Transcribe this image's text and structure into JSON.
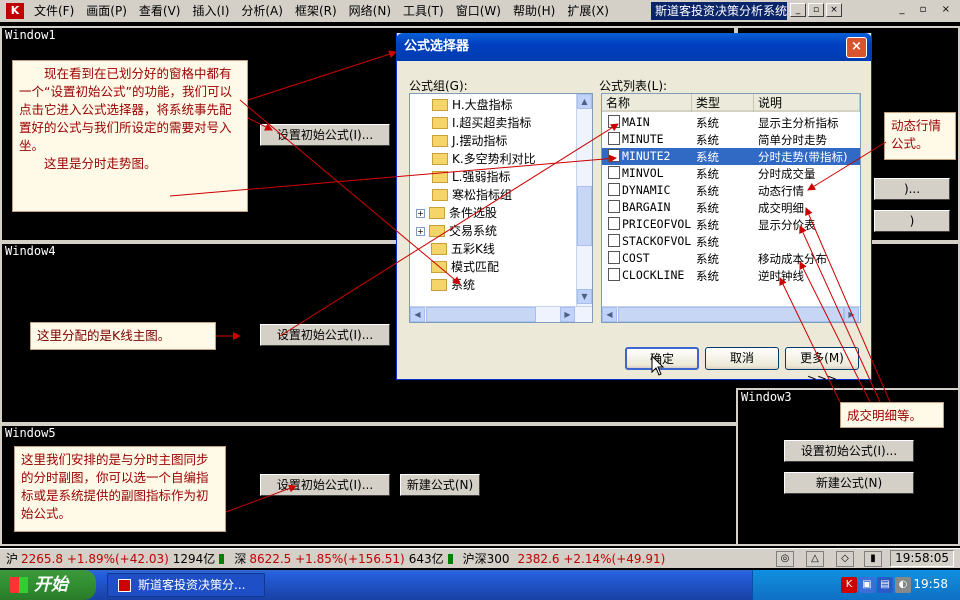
{
  "menubar": {
    "items": [
      "文件(F)",
      "画面(P)",
      "查看(V)",
      "插入(I)",
      "分析(A)",
      "框架(R)",
      "网络(N)",
      "工具(T)",
      "窗口(W)",
      "帮助(H)",
      "扩展(X)"
    ],
    "app_title": "斯道客投资决策分析系统"
  },
  "windows": {
    "w1": {
      "title": "Window1",
      "button": "设置初始公式(I)..."
    },
    "w4": {
      "title": "Window4",
      "button": "设置初始公式(I)..."
    },
    "w5": {
      "title": "Window5",
      "button": "设置初始公式(I)...",
      "button2": "新建公式(N)"
    },
    "w3": {
      "title": "Window3",
      "button": "设置初始公式(I)...",
      "button2": "新建公式(N)"
    }
  },
  "notes": {
    "n1": "　　现在看到在已划分好的窗格中都有一个“设置初始公式”的功能，我们可以点击它进入公式选择器，将系统事先配置好的公式与我们所设定的需要对号入坐。",
    "n1b": "　　这里是分时走势图。",
    "n2": "这里分配的是K线主图。",
    "n3": "这里我们安排的是与分时主图同步的分时副图，你可以选一个自编指标或是系统提供的副图指标作为初始公式。",
    "n4": "动态行情公式。",
    "n5": "成交明细等。"
  },
  "dialog": {
    "title": "公式选择器",
    "group_label": "公式组(G):",
    "list_label": "公式列表(L):",
    "tree": [
      {
        "label": "H.大盘指标",
        "indent": 2
      },
      {
        "label": "I.超买超卖指标",
        "indent": 2
      },
      {
        "label": "J.摆动指标",
        "indent": 2
      },
      {
        "label": "K.多空势利对比",
        "indent": 2
      },
      {
        "label": "L.强弱指标",
        "indent": 2
      },
      {
        "label": "寒松指标组",
        "indent": 2
      },
      {
        "label": "条件选股",
        "indent": 1,
        "expander": "+"
      },
      {
        "label": "交易系统",
        "indent": 1,
        "expander": "+"
      },
      {
        "label": "五彩K线",
        "indent": 1
      },
      {
        "label": "模式匹配",
        "indent": 1
      },
      {
        "label": "系统",
        "indent": 1,
        "open": true
      }
    ],
    "columns": [
      "名称",
      "类型",
      "说明"
    ],
    "rows": [
      {
        "name": "MAIN",
        "type": "系统",
        "desc": "显示主分析指标"
      },
      {
        "name": "MINUTE",
        "type": "系统",
        "desc": "简单分时走势"
      },
      {
        "name": "MINUTE2",
        "type": "系统",
        "desc": "分时走势(带指标)",
        "selected": true
      },
      {
        "name": "MINVOL",
        "type": "系统",
        "desc": "分时成交量"
      },
      {
        "name": "DYNAMIC",
        "type": "系统",
        "desc": "动态行情"
      },
      {
        "name": "BARGAIN",
        "type": "系统",
        "desc": "成交明细"
      },
      {
        "name": "PRICEOFVOL",
        "type": "系统",
        "desc": "显示分价表"
      },
      {
        "name": "STACKOFVOL",
        "type": "系统",
        "desc": ""
      },
      {
        "name": "COST",
        "type": "系统",
        "desc": "移动成本分布"
      },
      {
        "name": "CLOCKLINE",
        "type": "系统",
        "desc": "逆时钟线"
      }
    ],
    "ok": "确定",
    "cancel": "取消",
    "more": "更多(M) >>>"
  },
  "status": {
    "sh_label": "沪",
    "sh_value": "2265.8 +1.89%(+42.03)",
    "sh_amount": "1294亿",
    "sz_label": "深",
    "sz_value": "8622.5 +1.85%(+156.51)",
    "sz_amount": "643亿",
    "hs_label": "沪深300",
    "hs_value": "2382.6 +2.14%(+49.91)",
    "time": "19:58:05"
  },
  "taskbar": {
    "start": "开始",
    "task": "斯道客投资决策分...",
    "clock": "19:58"
  },
  "colors": {
    "note_text": "#990000",
    "up": "#c00000",
    "selection": "#316ac5"
  }
}
